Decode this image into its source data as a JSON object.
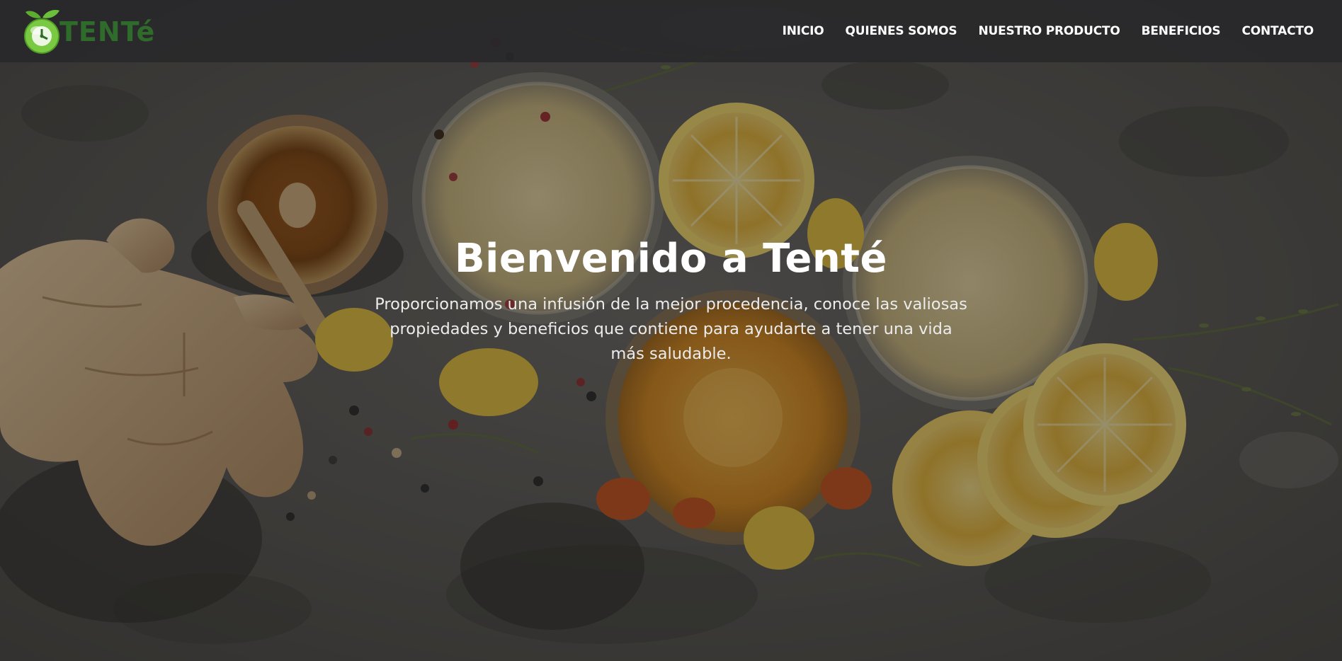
{
  "header": {
    "brand": {
      "logo_icon": "orange-fruit-logo-icon",
      "name": "TENTé"
    },
    "nav": [
      {
        "label": "INICIO"
      },
      {
        "label": "QUIENES SOMOS"
      },
      {
        "label": "NUESTRO PRODUCTO"
      },
      {
        "label": "BENEFICIOS"
      },
      {
        "label": "CONTACTO"
      }
    ]
  },
  "hero": {
    "title": "Bienvenido a Tenté",
    "description": "Proporcionamos una infusión de la mejor procedencia, conoce las valiosas propiedades y beneficios que contiene para ayudarte a tener una vida más saludable."
  },
  "colors": {
    "navbar_bg": "#28282a",
    "brand_green": "#2f6b2a",
    "logo_orange": "#7ac943",
    "text_white": "#ffffff"
  }
}
